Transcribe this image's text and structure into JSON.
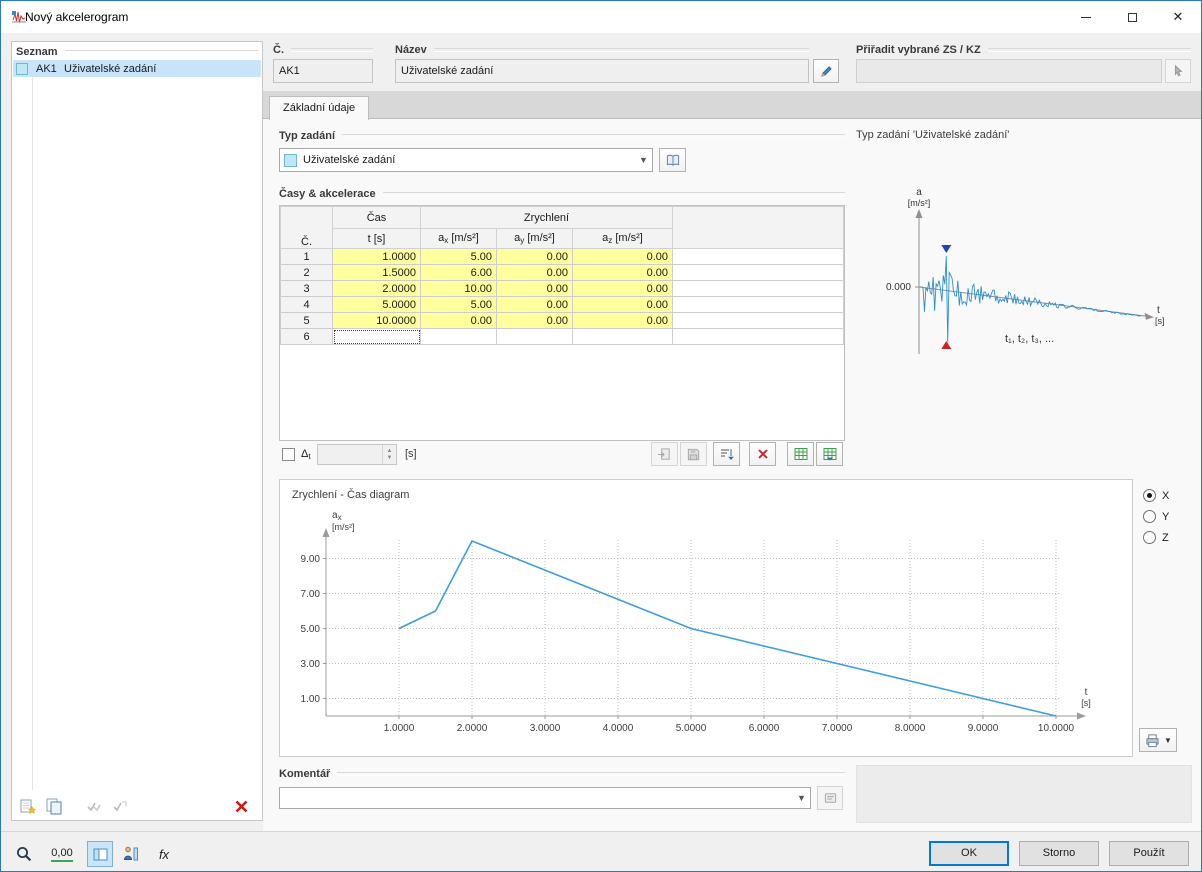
{
  "window": {
    "title": "Nový akcelerogram"
  },
  "list_panel": {
    "header": "Seznam",
    "items": [
      {
        "id": "AK1",
        "name": "Uživatelské zadání"
      }
    ]
  },
  "fields": {
    "number": {
      "label": "Č.",
      "value": "AK1"
    },
    "name": {
      "label": "Název",
      "value": "Uživatelské zadání"
    },
    "assign": {
      "label": "Přiřadit vybrané ZS / KZ",
      "value": ""
    }
  },
  "tab": {
    "label": "Základní údaje"
  },
  "type_section": {
    "header": "Typ zadání",
    "value": "Uživatelské zadání"
  },
  "table_section": {
    "header": "Časy & akcelerace",
    "col_no": "Č.",
    "col_time_top": "Čas",
    "col_time_bottom": "t [s]",
    "group_accel": "Zrychlení",
    "accel_cols": [
      {
        "base": "a",
        "sub": "x",
        "unit": "[m/s²]"
      },
      {
        "base": "a",
        "sub": "y",
        "unit": "[m/s²]"
      },
      {
        "base": "a",
        "sub": "z",
        "unit": "[m/s²]"
      }
    ],
    "rows": [
      {
        "no": "1",
        "t": "1.0000",
        "ax": "5.00",
        "ay": "0.00",
        "az": "0.00"
      },
      {
        "no": "2",
        "t": "1.5000",
        "ax": "6.00",
        "ay": "0.00",
        "az": "0.00"
      },
      {
        "no": "3",
        "t": "2.0000",
        "ax": "10.00",
        "ay": "0.00",
        "az": "0.00"
      },
      {
        "no": "4",
        "t": "5.0000",
        "ax": "5.00",
        "ay": "0.00",
        "az": "0.00"
      },
      {
        "no": "5",
        "t": "10.0000",
        "ax": "0.00",
        "ay": "0.00",
        "az": "0.00"
      },
      {
        "no": "6",
        "t": "",
        "ax": "",
        "ay": "",
        "az": ""
      }
    ],
    "delta": {
      "label_base": "Δ",
      "label_sub": "t",
      "value": "",
      "unit": "[s]"
    }
  },
  "preview": {
    "title": "Typ zadání 'Uživatelské zadání'",
    "axis_y_label": "a",
    "axis_y_unit": "[m/s²]",
    "zero_label": "0.000",
    "axis_x_label": "t",
    "axis_x_unit": "[s]",
    "sequence_label": "t₁, t₂, t₃, ..."
  },
  "diagram": {
    "title": "Zrychlení - Čas diagram",
    "radio": [
      {
        "label": "X",
        "checked": true
      },
      {
        "label": "Y",
        "checked": false
      },
      {
        "label": "Z",
        "checked": false
      }
    ]
  },
  "comment": {
    "header": "Komentář",
    "value": ""
  },
  "footer": {
    "ok": "OK",
    "cancel": "Storno",
    "apply": "Použít"
  },
  "statusbar": {
    "units_label": "0,00",
    "fx_label": "fx"
  },
  "chart_data": {
    "type": "line",
    "title": "Zrychlení - Čas diagram",
    "x": [
      1.0,
      1.5,
      2.0,
      5.0,
      10.0
    ],
    "y": [
      5.0,
      6.0,
      10.0,
      5.0,
      0.0
    ],
    "xlabel_main": "t",
    "xlabel_unit": "[s]",
    "ylabel_base": "a",
    "ylabel_sub": "x",
    "ylabel_unit": "[m/s²]",
    "xlim": [
      0,
      10.3
    ],
    "ylim": [
      0,
      10.8
    ],
    "x_ticks": [
      1,
      2,
      3,
      4,
      5,
      6,
      7,
      8,
      9,
      10
    ],
    "x_tick_labels": [
      "1.0000",
      "2.0000",
      "3.0000",
      "4.0000",
      "5.0000",
      "6.0000",
      "7.0000",
      "8.0000",
      "9.0000",
      "10.0000"
    ],
    "y_ticks": [
      1,
      3,
      5,
      7,
      9
    ],
    "y_tick_labels": [
      "1.00",
      "3.00",
      "5.00",
      "7.00",
      "9.00"
    ],
    "grid": "dotted",
    "line_color": "#3f9edd"
  }
}
